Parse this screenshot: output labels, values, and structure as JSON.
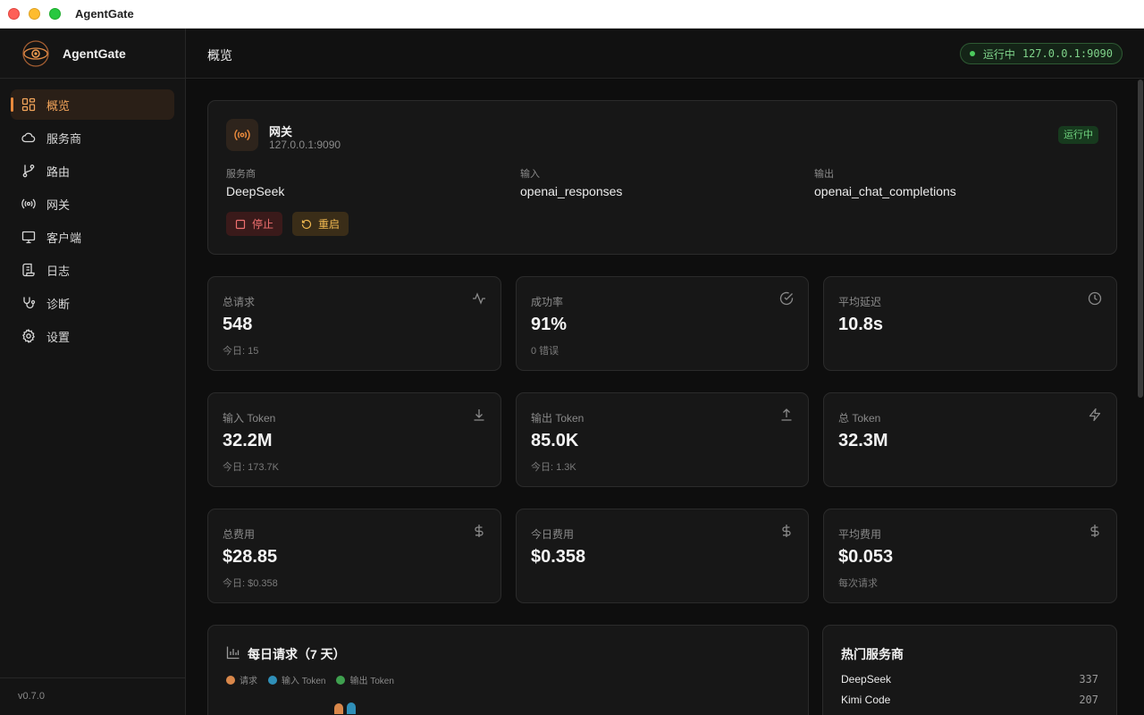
{
  "window": {
    "title": "AgentGate"
  },
  "sidebar": {
    "app_name": "AgentGate",
    "items": [
      {
        "label": "概览",
        "icon": "dashboard-icon",
        "active": true
      },
      {
        "label": "服务商",
        "icon": "cloud-icon",
        "active": false
      },
      {
        "label": "路由",
        "icon": "git-branch-icon",
        "active": false
      },
      {
        "label": "网关",
        "icon": "radio-tower-icon",
        "active": false
      },
      {
        "label": "客户端",
        "icon": "monitor-icon",
        "active": false
      },
      {
        "label": "日志",
        "icon": "scroll-icon",
        "active": false
      },
      {
        "label": "诊断",
        "icon": "stethoscope-icon",
        "active": false
      },
      {
        "label": "设置",
        "icon": "gear-icon",
        "active": false
      }
    ],
    "version": "v0.7.0"
  },
  "header": {
    "title": "概览",
    "status_label": "运行中",
    "status_address": "127.0.0.1:9090"
  },
  "gateway": {
    "name": "网关",
    "address": "127.0.0.1:9090",
    "status": "运行中",
    "provider_label": "服务商",
    "provider_value": "DeepSeek",
    "input_label": "输入",
    "input_value": "openai_responses",
    "output_label": "输出",
    "output_value": "openai_chat_completions",
    "stop_label": "停止",
    "restart_label": "重启"
  },
  "stats": [
    {
      "label": "总请求",
      "value": "548",
      "sub": "今日: 15",
      "icon": "activity-icon"
    },
    {
      "label": "成功率",
      "value": "91%",
      "sub": "0 错误",
      "icon": "check-circle-icon"
    },
    {
      "label": "平均延迟",
      "value": "10.8s",
      "sub": "",
      "icon": "clock-icon"
    },
    {
      "label": "输入 Token",
      "value": "32.2M",
      "sub": "今日: 173.7K",
      "icon": "download-icon"
    },
    {
      "label": "输出 Token",
      "value": "85.0K",
      "sub": "今日: 1.3K",
      "icon": "upload-icon"
    },
    {
      "label": "总 Token",
      "value": "32.3M",
      "sub": "",
      "icon": "zap-icon"
    },
    {
      "label": "总费用",
      "value": "$28.85",
      "sub": "今日: $0.358",
      "icon": "dollar-icon"
    },
    {
      "label": "今日费用",
      "value": "$0.358",
      "sub": "",
      "icon": "dollar-icon"
    },
    {
      "label": "平均费用",
      "value": "$0.053",
      "sub": "每次请求",
      "icon": "dollar-icon"
    }
  ],
  "daily_chart": {
    "title": "每日请求（7 天）",
    "legend": [
      {
        "name": "请求",
        "color": "#d9874a"
      },
      {
        "name": "输入 Token",
        "color": "#2f8fb8"
      },
      {
        "name": "输出 Token",
        "color": "#3fa04f"
      }
    ]
  },
  "top_providers": {
    "title": "热门服务商",
    "rows": [
      {
        "name": "DeepSeek",
        "count": "337"
      },
      {
        "name": "Kimi Code",
        "count": "207"
      }
    ]
  },
  "colors": {
    "accent": "#e8893c",
    "running_green": "#4ccb5e",
    "stop_red": "#f07070",
    "restart_amber": "#f0b850"
  }
}
